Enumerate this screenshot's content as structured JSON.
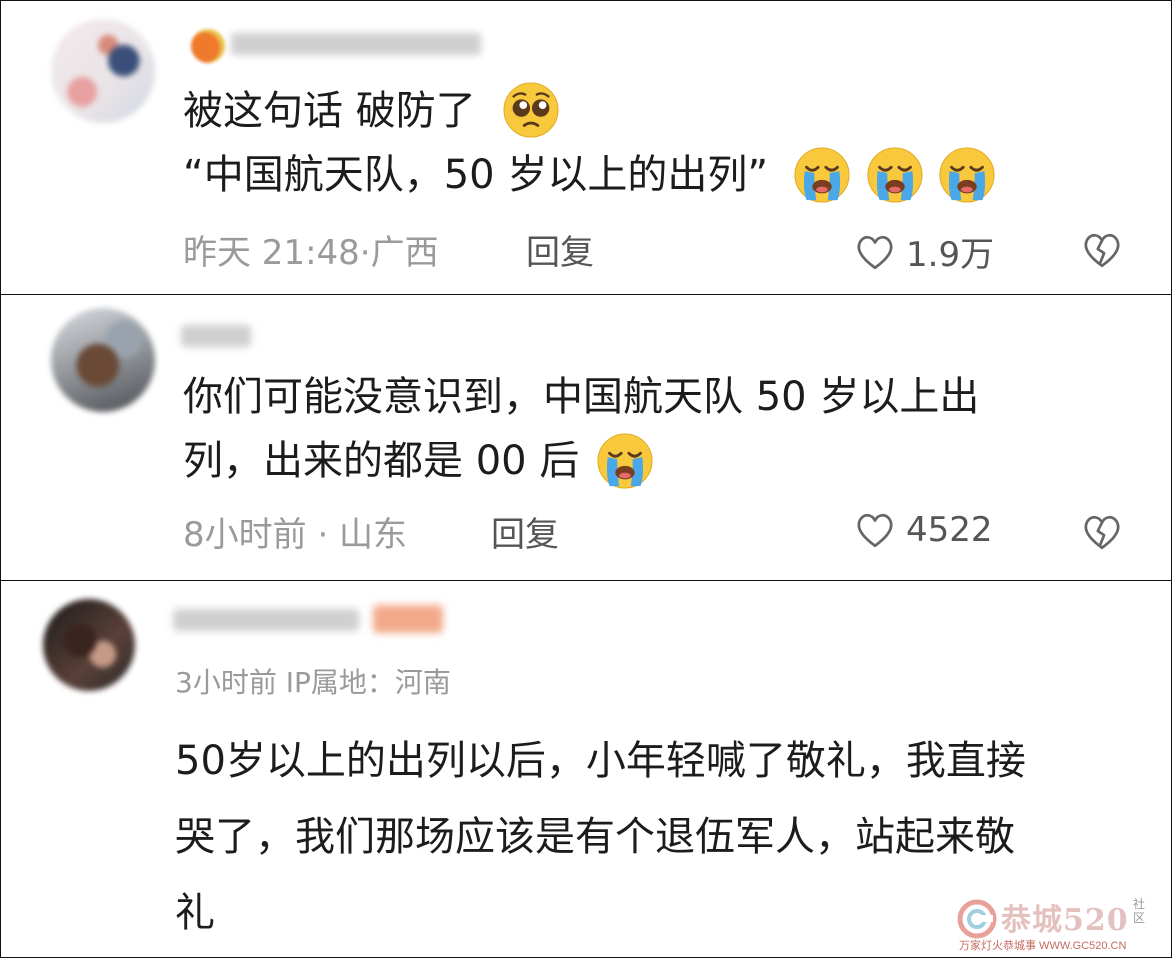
{
  "comments": [
    {
      "text_line1": "被这句话  破防了",
      "text_line2": "“中国航天队，50 岁以上的出列”",
      "time": "昨天 21:48·广西",
      "reply": "回复",
      "likes": "1.9万"
    },
    {
      "text_line1": "你们可能没意识到，中国航天队 50 岁以上出",
      "text_line2": "列，出来的都是 00 后",
      "time": "8小时前 · 山东",
      "reply": "回复",
      "likes": "4522"
    },
    {
      "meta": "3小时前  IP属地：河南",
      "text_line1": "50岁以上的出列以后，小年轻喊了敬礼，我直接",
      "text_line2": "哭了，我们那场应该是有个退伍军人，站起来敬",
      "text_line3": "礼"
    }
  ],
  "watermark": {
    "title": "恭城520",
    "side": "社区",
    "subtitle": "万家灯火恭城事 WWW.GC520.CN"
  },
  "icons": {
    "pleading": "pleading-face-icon",
    "crying": "loudly-crying-face-icon",
    "heart": "heart-outline-icon",
    "dislike": "broken-heart-icon"
  }
}
